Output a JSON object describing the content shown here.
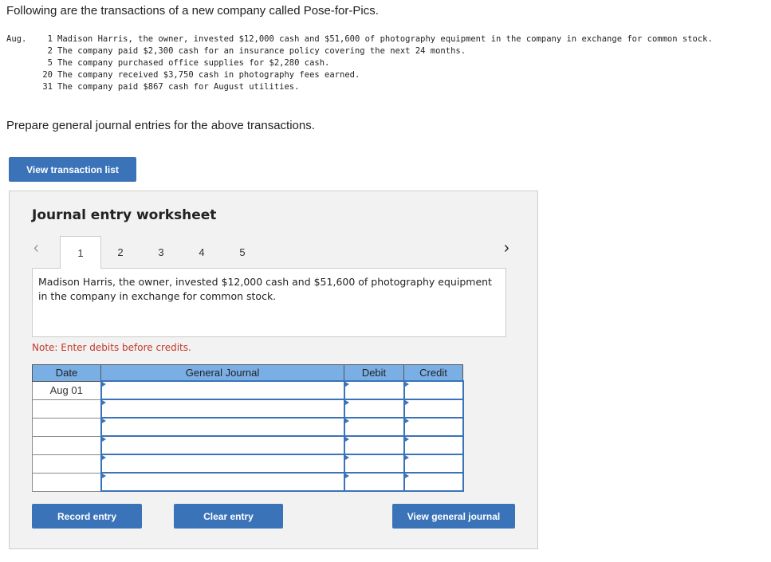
{
  "intro": "Following are the transactions of a new company called Pose-for-Pics.",
  "transactions": [
    {
      "month": "Aug.",
      "day": "1",
      "text": "Madison Harris, the owner, invested $12,000 cash and $51,600 of photography equipment in the company in exchange for common stock."
    },
    {
      "month": "",
      "day": "2",
      "text": "The company paid $2,300 cash for an insurance policy covering the next 24 months."
    },
    {
      "month": "",
      "day": "5",
      "text": "The company purchased office supplies for $2,280 cash."
    },
    {
      "month": "",
      "day": "20",
      "text": "The company received $3,750 cash in photography fees earned."
    },
    {
      "month": "",
      "day": "31",
      "text": "The company paid $867 cash for August utilities."
    }
  ],
  "prepare": "Prepare general journal entries for the above transactions.",
  "view_transaction_list": "View transaction list",
  "worksheet": {
    "title": "Journal entry worksheet",
    "tabs": [
      "1",
      "2",
      "3",
      "4",
      "5"
    ],
    "active_tab": "1",
    "description": "Madison Harris, the owner, invested $12,000 cash and $51,600 of photography equipment in the company in exchange for common stock.",
    "note": "Note: Enter debits before credits.",
    "headers": [
      "Date",
      "General Journal",
      "Debit",
      "Credit"
    ],
    "rows": [
      {
        "date": "Aug 01"
      },
      {
        "date": ""
      },
      {
        "date": ""
      },
      {
        "date": ""
      },
      {
        "date": ""
      },
      {
        "date": ""
      }
    ],
    "record": "Record entry",
    "clear": "Clear entry",
    "view_journal": "View general journal"
  }
}
